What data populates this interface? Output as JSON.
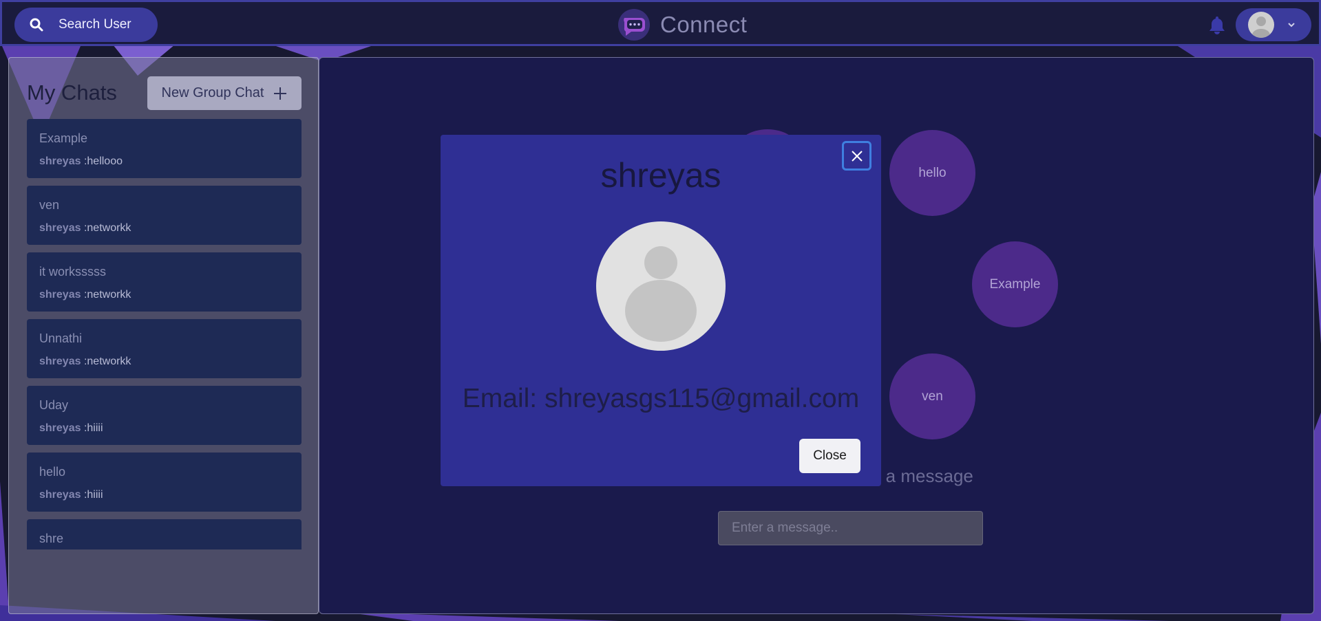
{
  "colors": {
    "accent": "#3b3b9c",
    "modal": "#2f2f94",
    "panel": "#1a1a4c",
    "bubble": "#4c2a8a"
  },
  "header": {
    "search_label": "Search User",
    "search_icon": "search-icon",
    "app_title": "Connect",
    "notification_icon": "bell-icon"
  },
  "sidebar": {
    "title": "My Chats",
    "new_group_label": "New Group Chat",
    "chats": [
      {
        "name": "Example",
        "sender": "shreyas",
        "message": ":hellooo"
      },
      {
        "name": "ven",
        "sender": "shreyas",
        "message": ":networkk"
      },
      {
        "name": "it worksssss",
        "sender": "shreyas",
        "message": ":networkk"
      },
      {
        "name": "Unnathi",
        "sender": "shreyas",
        "message": ":networkk"
      },
      {
        "name": "Uday",
        "sender": "shreyas",
        "message": ":hiiii"
      },
      {
        "name": "hello",
        "sender": "shreyas",
        "message": ":hiiii"
      },
      {
        "name": "shre",
        "sender": "",
        "message": ""
      }
    ]
  },
  "main": {
    "bubbles": [
      "hello",
      "Example",
      "ven"
    ],
    "select_prompt": "d a message",
    "message_placeholder": "Enter a message.."
  },
  "modal": {
    "title": "shreyas",
    "email": "Email: shreyasgs115@gmail.com",
    "close_label": "Close"
  }
}
